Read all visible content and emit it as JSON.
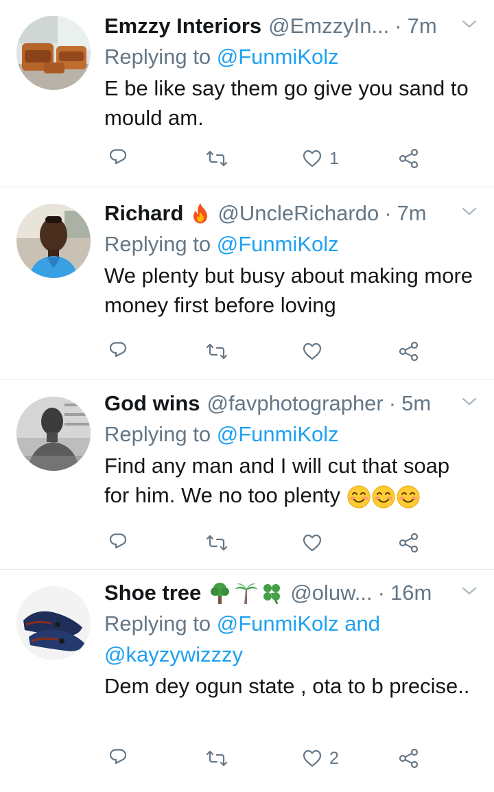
{
  "replying_prefix": "Replying to",
  "tweets": [
    {
      "name": "Emzzy Interiors",
      "handle": "@EmzzyIn...",
      "separator": "·",
      "time": "7m",
      "replying_to": "@FunmiKolz",
      "replying_to_extra": "",
      "text": "E be like say them go give you sand to mould am.",
      "like_count": "1",
      "avatar": "sofa-photo"
    },
    {
      "name": "Richard",
      "name_emoji": "fire",
      "handle": "@UncleRichardo",
      "separator": "·",
      "time": "7m",
      "replying_to": "@FunmiKolz",
      "text": "We plenty but busy about making more money first before loving",
      "like_count": "",
      "avatar": "man-in-car-photo"
    },
    {
      "name": "God wins",
      "handle": "@favphotographer",
      "separator": "·",
      "time": "5m",
      "replying_to": "@FunmiKolz",
      "text": "Find any man and I will cut that soap for him. We no too plenty",
      "text_emoji": [
        "smiling-face",
        "smiling-face",
        "smiling-face"
      ],
      "like_count": "",
      "avatar": "shirtless-man-photo"
    },
    {
      "name": "Shoe tree",
      "name_emoji": [
        "deciduous-tree",
        "palm-tree",
        "four-leaf-clover"
      ],
      "handle": "@oluw...",
      "separator": "·",
      "time": "16m",
      "replying_to": "@FunmiKolz and",
      "replying_to_2": "@kayzywizzzy",
      "text": "Dem dey ogun state , ota to b precise..",
      "like_count": "2",
      "avatar": "loafer-shoes-photo"
    }
  ],
  "colors": {
    "name": "#14171a",
    "muted": "#657786",
    "link": "#1da1f2",
    "divider": "#e1e8ed"
  }
}
